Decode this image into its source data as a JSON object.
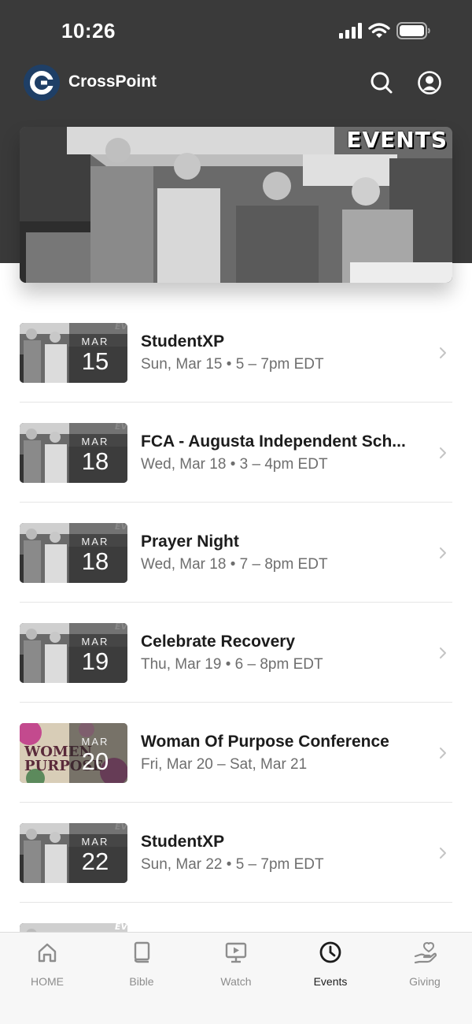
{
  "status": {
    "time": "10:26"
  },
  "app": {
    "title": "CrossPoint",
    "logo_letter": "C"
  },
  "hero": {
    "title": "EVENTS"
  },
  "events": [
    {
      "tag": "EV",
      "month": "MAR",
      "day": "15",
      "title": "StudentXP",
      "subtitle": "Sun, Mar 15 • 5 – 7pm EDT",
      "thumb": "photo"
    },
    {
      "tag": "EV",
      "month": "MAR",
      "day": "18",
      "title": "FCA - Augusta Independent Sch...",
      "subtitle": "Wed, Mar 18 • 3 – 4pm EDT",
      "thumb": "photo"
    },
    {
      "tag": "EV",
      "month": "MAR",
      "day": "18",
      "title": "Prayer Night",
      "subtitle": "Wed, Mar 18 • 7 – 8pm EDT",
      "thumb": "photo"
    },
    {
      "tag": "EV",
      "month": "MAR",
      "day": "19",
      "title": "Celebrate Recovery",
      "subtitle": "Thu, Mar 19 • 6 – 8pm EDT",
      "thumb": "photo"
    },
    {
      "tag": "",
      "month": "MAR",
      "day": "20",
      "title": "Woman Of Purpose Conference",
      "subtitle": "Fri, Mar 20 – Sat, Mar 21",
      "thumb": "floral",
      "thumb_text": "WOMEN OF PURPOSE"
    },
    {
      "tag": "EV",
      "month": "MAR",
      "day": "22",
      "title": "StudentXP",
      "subtitle": "Sun, Mar 22 • 5 – 7pm EDT",
      "thumb": "photo"
    },
    {
      "tag": "EV",
      "month": "",
      "day": "",
      "title": "",
      "subtitle": "",
      "thumb": "photo"
    }
  ],
  "tabs": [
    {
      "label": "HOME",
      "icon": "home-icon",
      "active": false
    },
    {
      "label": "Bible",
      "icon": "book-icon",
      "active": false
    },
    {
      "label": "Watch",
      "icon": "play-icon",
      "active": false
    },
    {
      "label": "Events",
      "icon": "clock-icon",
      "active": true
    },
    {
      "label": "Giving",
      "icon": "heart-hand-icon",
      "active": false
    }
  ],
  "colors": {
    "header": "#3a3a3a",
    "logo": "#1f3f66",
    "tab_active": "#1c1c1c",
    "tab_inactive": "#8d8d8d"
  }
}
